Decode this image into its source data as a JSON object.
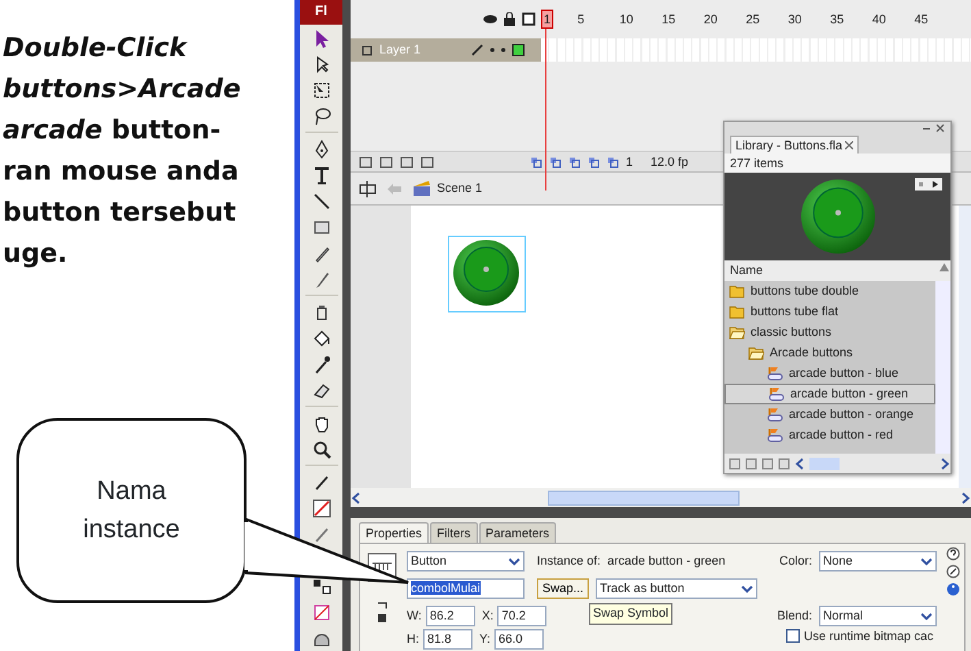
{
  "document": {
    "text": "*Double-Click*\n*buttons>Arcade*\n*arcade* button-\nran mouse anda\nbutton tersebut\nuge.",
    "callout": "Nama instance"
  },
  "flash": {
    "logo": "Fl",
    "timeline": {
      "frame_numbers": [
        "1",
        "5",
        "10",
        "15",
        "20",
        "25",
        "30",
        "35",
        "40",
        "45"
      ],
      "layers": [
        {
          "name": "Layer 1",
          "selected": true
        }
      ],
      "current_frame": "1",
      "frame_rate": "12.0 fp"
    },
    "edit_bar": {
      "scene": "Scene 1"
    },
    "library": {
      "title": "Library - Buttons.fla",
      "count": "277 items",
      "column": "Name",
      "items": [
        {
          "name": "buttons tube double",
          "kind": "folder",
          "expanded": false,
          "selected": false
        },
        {
          "name": "buttons tube flat",
          "kind": "folder",
          "expanded": false,
          "selected": false
        },
        {
          "name": "classic buttons",
          "kind": "folder",
          "expanded": true,
          "selected": false,
          "children": [
            {
              "name": "Arcade buttons",
              "kind": "folder",
              "expanded": true,
              "selected": false,
              "children": [
                {
                  "name": "arcade button - blue",
                  "kind": "button",
                  "selected": false
                },
                {
                  "name": "arcade button - green",
                  "kind": "button",
                  "selected": true
                },
                {
                  "name": "arcade button - orange",
                  "kind": "button",
                  "selected": false
                },
                {
                  "name": "arcade button - red",
                  "kind": "button",
                  "selected": false
                }
              ]
            }
          ]
        }
      ]
    },
    "properties": {
      "tabs": [
        {
          "label": "Properties",
          "selected": true
        },
        {
          "label": "Filters",
          "selected": false
        },
        {
          "label": "Parameters",
          "selected": false
        }
      ],
      "symbol_type": "Button",
      "instance_name": "combolMulai",
      "instance_of_label": "Instance of:",
      "instance_of": "arcade button - green",
      "color_label": "Color:",
      "color_effect": "None",
      "swap_button": "Swap...",
      "tracking": "Track as button",
      "tooltip": "Swap Symbol",
      "fields": [
        {
          "label": "W:",
          "value": "86.2"
        },
        {
          "label": "X:",
          "value": "70.2"
        },
        {
          "label": "H:",
          "value": "81.8"
        },
        {
          "label": "Y:",
          "value": "66.0"
        }
      ],
      "blend_label": "Blend:",
      "blend": "Normal",
      "runtime_cache": {
        "label": "Use runtime bitmap cac",
        "checked": false
      }
    }
  }
}
